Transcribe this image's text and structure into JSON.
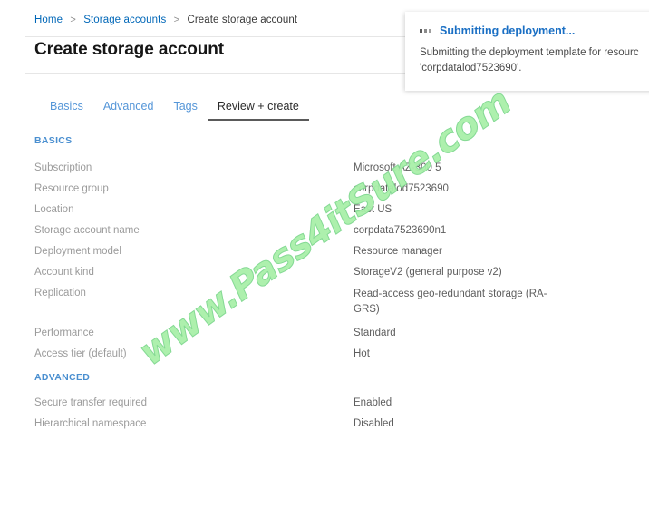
{
  "breadcrumb": {
    "home": "Home",
    "sep": ">",
    "storage_accounts": "Storage accounts",
    "current": "Create storage account"
  },
  "page": {
    "title": "Create storage account"
  },
  "tabs": [
    {
      "label": "Basics",
      "active": false
    },
    {
      "label": "Advanced",
      "active": false
    },
    {
      "label": "Tags",
      "active": false
    },
    {
      "label": "Review + create",
      "active": true
    }
  ],
  "sections": {
    "basics": {
      "heading": "BASICS",
      "rows": [
        {
          "key": "Subscription",
          "value": "Microsoft AZ-300 5"
        },
        {
          "key": "Resource group",
          "value": "corpdatalod7523690"
        },
        {
          "key": "Location",
          "value": "East US"
        },
        {
          "key": "Storage account name",
          "value": "corpdata7523690n1"
        },
        {
          "key": "Deployment model",
          "value": "Resource manager"
        },
        {
          "key": "Account kind",
          "value": "StorageV2 (general purpose v2)"
        },
        {
          "key": "Replication",
          "value": "Read-access geo-redundant storage (RA-GRS)"
        },
        {
          "key": "Performance",
          "value": "Standard"
        },
        {
          "key": "Access tier (default)",
          "value": "Hot"
        }
      ]
    },
    "advanced": {
      "heading": "ADVANCED",
      "rows": [
        {
          "key": "Secure transfer required",
          "value": "Enabled"
        },
        {
          "key": "Hierarchical namespace",
          "value": "Disabled"
        }
      ]
    }
  },
  "notification": {
    "icon": "progress-dots-icon",
    "title": "Submitting deployment...",
    "body_line1": "Submitting the deployment template for resourc",
    "body_line2": "'corpdatalod7523690'."
  },
  "watermark": {
    "text": "www.Pass4itSure.com",
    "color": "#a9f0a9"
  },
  "colors": {
    "link": "#0067b8",
    "tab_inactive": "#5596d8",
    "section_heading": "#4a8fd0",
    "key_text": "#9b9b9b",
    "value_text": "#5e5e5e",
    "notification_title": "#1a6fc4"
  }
}
